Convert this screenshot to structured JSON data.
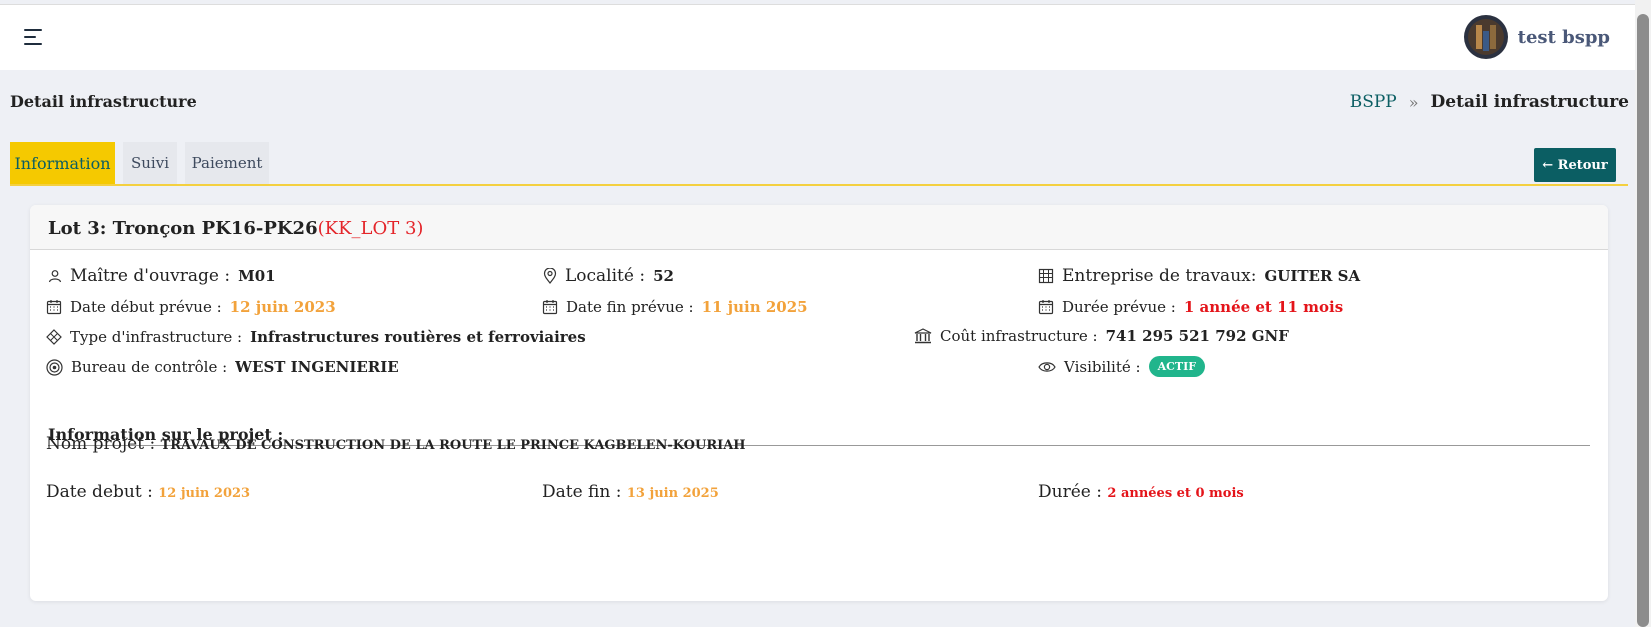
{
  "user": {
    "name": "test bspp"
  },
  "page": {
    "title": "Detail infrastructure"
  },
  "breadcrumb": {
    "root": "BSPP",
    "current": "Detail infrastructure"
  },
  "tabs": [
    {
      "label": "Information"
    },
    {
      "label": "Suivi"
    },
    {
      "label": "Paiement"
    }
  ],
  "retour_label": "← Retour",
  "card": {
    "title": "Lot 3: Tronçon PK16-PK26",
    "code": "(KK_LOT 3)",
    "maitre": {
      "label": "Maître d'ouvrage :",
      "value": "M01"
    },
    "localite": {
      "label": "Localité :",
      "value": "52"
    },
    "entreprise": {
      "label": "Entreprise de travaux:",
      "value": "GUITER SA"
    },
    "date_debut": {
      "label": "Date début prévue :",
      "value": "12 juin 2023"
    },
    "date_fin": {
      "label": "Date fin prévue :",
      "value": "11 juin 2025"
    },
    "duree": {
      "label": "Durée prévue :",
      "value": "1 année et 11 mois"
    },
    "type": {
      "label": "Type d'infrastructure :",
      "value": "Infrastructures routières et ferroviaires"
    },
    "cout": {
      "label": "Coût infrastructure :",
      "value": "741 295 521 792 GNF"
    },
    "bureau": {
      "label": "Bureau de contrôle :",
      "value": "WEST INGENIERIE"
    },
    "visibilite": {
      "label": "Visibilité :",
      "value": "ACTIF"
    }
  },
  "projet": {
    "section_title": "Information sur le projet :",
    "nom": {
      "label": "Nom projet :",
      "value": "TRAVAUX DE CONSTRUCTION DE LA ROUTE LE PRINCE KAGBELEN-KOURIAH"
    },
    "date_debut": {
      "label": "Date debut :",
      "value": "12 juin 2023"
    },
    "date_fin": {
      "label": "Date fin :",
      "value": "13 juin 2025"
    },
    "duree": {
      "label": "Durée :",
      "value": "2 années et 0 mois"
    }
  },
  "colors": {
    "primary": "#0b5e63",
    "tab_active": "#f5c900",
    "orange": "#f2a23b",
    "red": "#e4141a",
    "badge": "#21b58c"
  }
}
